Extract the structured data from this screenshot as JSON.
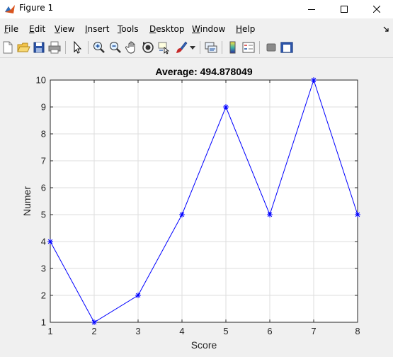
{
  "window": {
    "title": "Figure 1",
    "controls": [
      "minimize",
      "maximize",
      "close"
    ]
  },
  "menu": {
    "items": [
      {
        "label": "File",
        "mnemonic": "F",
        "rest": "ile"
      },
      {
        "label": "Edit",
        "mnemonic": "E",
        "rest": "dit"
      },
      {
        "label": "View",
        "mnemonic": "V",
        "rest": "iew"
      },
      {
        "label": "Insert",
        "mnemonic": "I",
        "rest": "nsert"
      },
      {
        "label": "Tools",
        "mnemonic": "T",
        "rest": "ools"
      },
      {
        "label": "Desktop",
        "mnemonic": "D",
        "rest": "esktop"
      },
      {
        "label": "Window",
        "mnemonic": "W",
        "rest": "indow"
      },
      {
        "label": "Help",
        "mnemonic": "H",
        "rest": "elp"
      }
    ]
  },
  "toolbar": {
    "icons": [
      "new-figure-icon",
      "open-file-icon",
      "save-icon",
      "print-icon",
      "select-arrow-icon",
      "zoom-in-icon",
      "zoom-out-icon",
      "pan-icon",
      "rotate-3d-icon",
      "data-cursor-icon",
      "brush-icon",
      "brush-dropdown-icon",
      "link-plot-icon",
      "colorbar-icon",
      "legend-icon",
      "hide-plot-tools-icon",
      "show-plot-tools-icon"
    ]
  },
  "colors": {
    "line": "#0000ff",
    "axes_bg": "#ffffff",
    "grid": "#dedede",
    "figure_bg": "#f0f0f0"
  },
  "chart_data": {
    "type": "line",
    "title": "Average: 494.878049",
    "xlabel": "Score",
    "ylabel": "Numer",
    "x": [
      1,
      2,
      3,
      4,
      5,
      6,
      7,
      8
    ],
    "y": [
      4,
      1,
      2,
      5,
      9,
      5,
      10,
      5
    ],
    "marker": "*",
    "xlim": [
      1,
      8
    ],
    "ylim": [
      1,
      10
    ],
    "xticks": [
      "1",
      "2",
      "3",
      "4",
      "5",
      "6",
      "7",
      "8"
    ],
    "yticks": [
      "1",
      "2",
      "3",
      "4",
      "5",
      "6",
      "7",
      "8",
      "9",
      "10"
    ],
    "grid": true,
    "legend": false
  }
}
